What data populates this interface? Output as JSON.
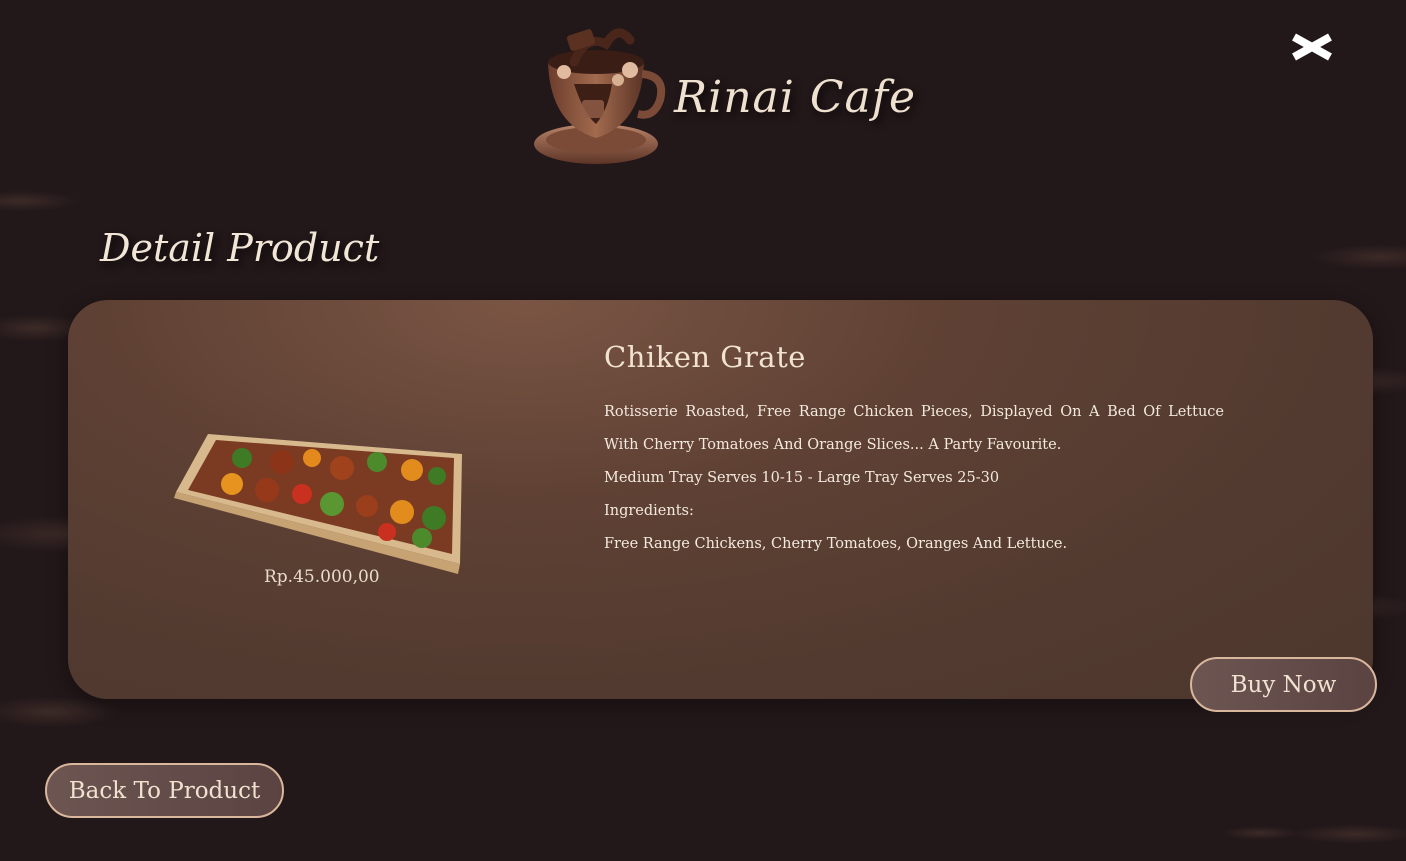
{
  "header": {
    "brand": "Rinai Cafe",
    "logo_icon": "coffee-cup-logo-icon",
    "close_icon": "close-icon"
  },
  "section": {
    "title": "Detail Product"
  },
  "product": {
    "image_icon": "chicken-tray-image",
    "price": "Rp.45.000,00",
    "name": "Chiken Grate",
    "description": [
      "Rotisserie Roasted, Free Range Chicken Pieces, Displayed On A Bed Of Lettuce With Cherry Tomatoes And Orange Slices... A Party Favourite.",
      "Medium Tray Serves 10-15 - Large Tray Serves 25-30",
      "Ingredients:",
      "Free Range Chickens, Cherry Tomatoes, Oranges And Lettuce."
    ]
  },
  "actions": {
    "buy_label": "Buy Now",
    "back_label": "Back To Product"
  },
  "colors": {
    "background": "#221719",
    "card": "#5f4134",
    "text_light": "#f1e3d2",
    "button_border": "#d9b79c"
  }
}
